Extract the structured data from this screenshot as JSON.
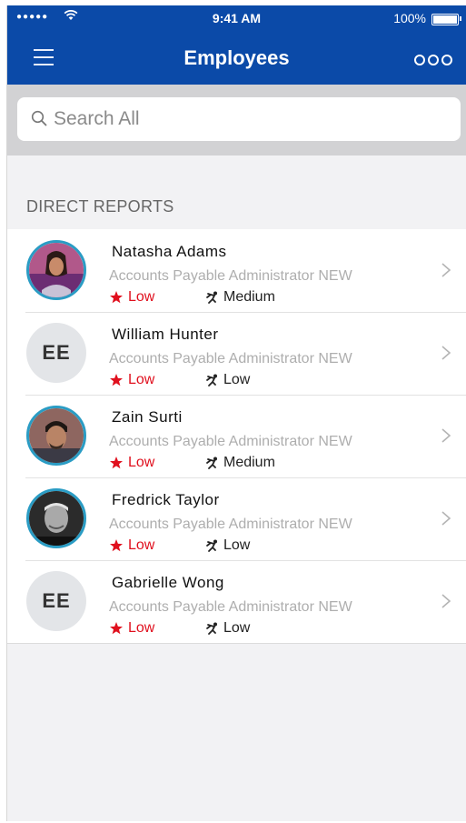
{
  "status_bar": {
    "signal": "●●●●●",
    "time": "9:41 AM",
    "battery": "100%"
  },
  "header": {
    "title": "Employees"
  },
  "search": {
    "placeholder": "Search All"
  },
  "section": {
    "title": "DIRECT REPORTS"
  },
  "employees": [
    {
      "name": "Natasha Adams",
      "title": "Accounts Payable Administrator NEW",
      "metric_a": "Low",
      "metric_b": "Medium",
      "avatar": "photo"
    },
    {
      "name": "William Hunter",
      "title": "Accounts Payable Administrator NEW",
      "metric_a": "Low",
      "metric_b": "Low",
      "avatar": "EE"
    },
    {
      "name": "Zain Surti",
      "title": "Accounts Payable Administrator NEW",
      "metric_a": "Low",
      "metric_b": "Medium",
      "avatar": "photo"
    },
    {
      "name": "Fredrick Taylor",
      "title": "Accounts Payable Administrator NEW",
      "metric_a": "Low",
      "metric_b": "Low",
      "avatar": "photo"
    },
    {
      "name": "Gabrielle Wong",
      "title": "Accounts Payable Administrator NEW",
      "metric_a": "Low",
      "metric_b": "Low",
      "avatar": "EE"
    }
  ],
  "colors": {
    "brand": "#0b4aa8",
    "alert": "#e0101e",
    "avatar_ring": "#2a9cc4"
  },
  "icons": {
    "menu": "hamburger-icon",
    "more": "more-options-icon",
    "search": "search-icon",
    "metric_a": "star-icon",
    "metric_b": "runner-icon",
    "row_action": "chevron-right-icon"
  }
}
